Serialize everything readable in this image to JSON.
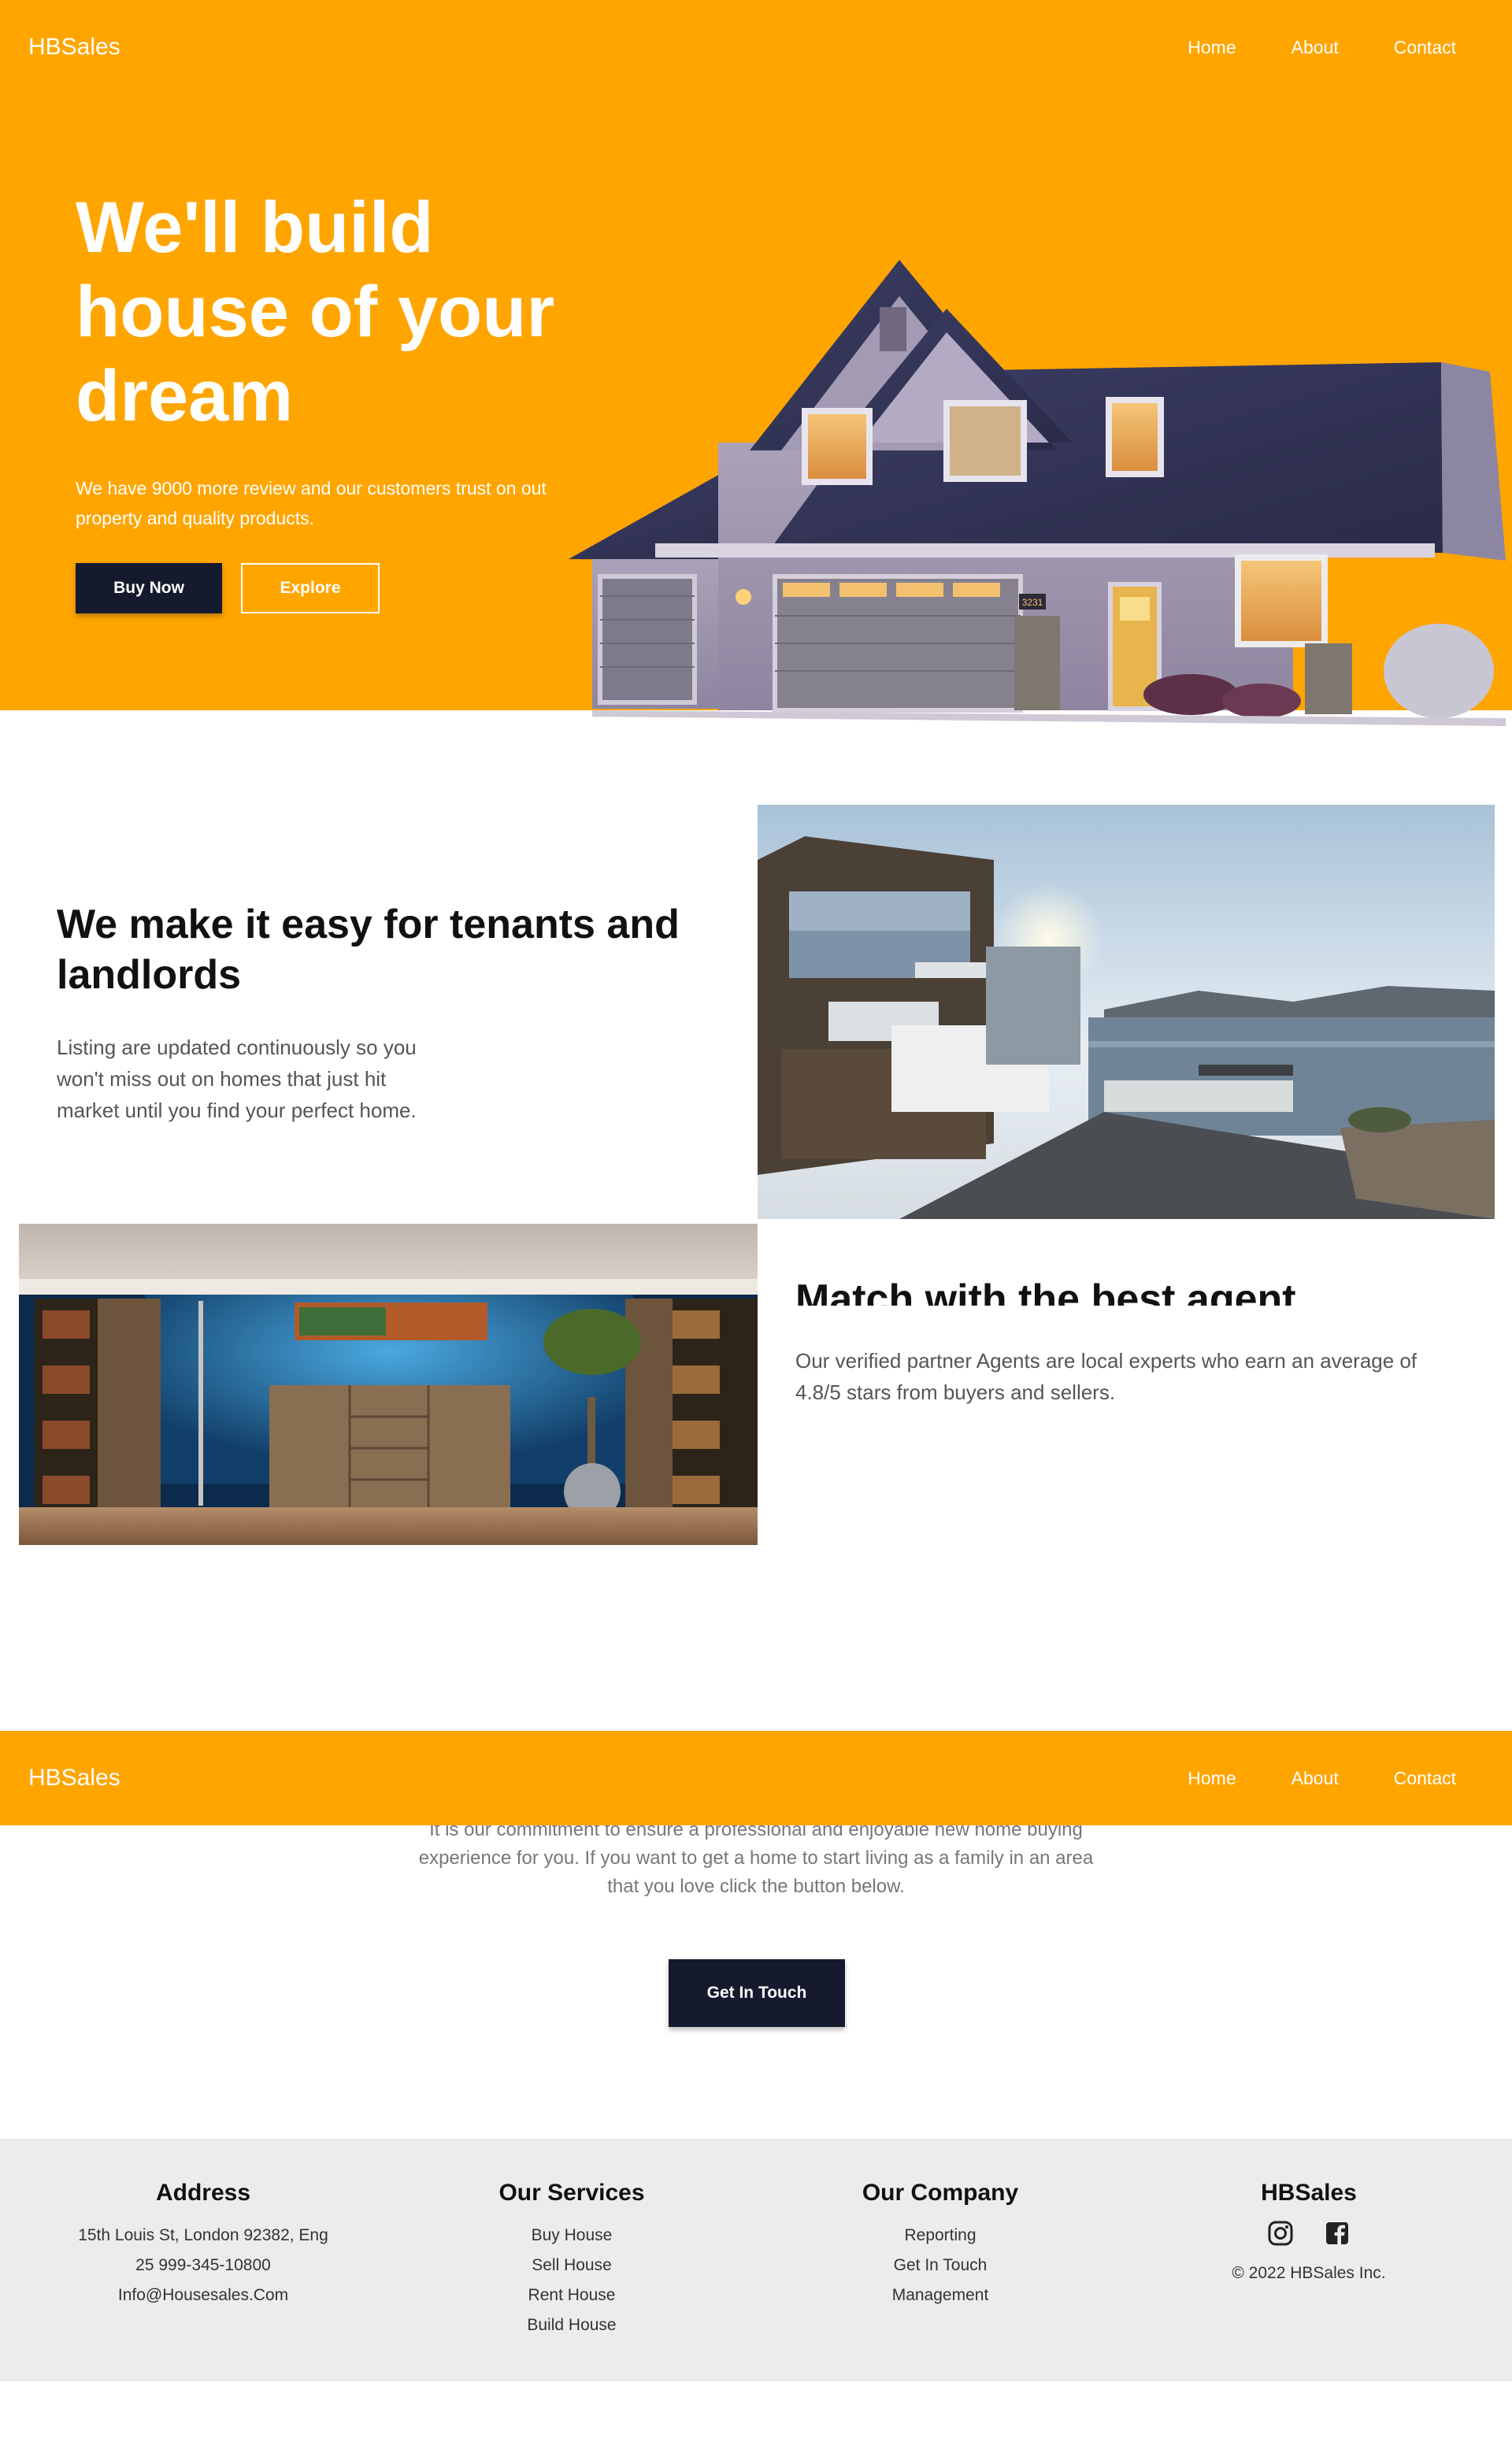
{
  "nav": {
    "brand": "HBSales",
    "links": [
      "Home",
      "About",
      "Contact"
    ]
  },
  "hero": {
    "title": "We'll build house of your dream",
    "text": "We have 9000 more review and our customers trust on out property and quality products.",
    "buy_label": "Buy Now",
    "explore_label": "Explore",
    "house_number": "3231"
  },
  "feature1": {
    "title": "We make it easy for tenants and landlords",
    "text": "Listing are updated continuously so you won't miss out on homes that just hit market until you find your perfect home."
  },
  "feature2": {
    "title": "Match with the best agent",
    "text": "Our verified partner Agents are local experts who earn an average of 4.8/5 stars from buyers and sellers."
  },
  "cta": {
    "text": "It is our commitment to ensure a professional and enjoyable new home buying experience for you. If you want to get a home to start living as a family in an area that you love click the button below.",
    "button_label": "Get In Touch"
  },
  "footer": {
    "address": {
      "title": "Address",
      "lines": [
        "15th Louis St, London 92382, Eng",
        "25 999-345-10800",
        "Info@Housesales.Com"
      ]
    },
    "services": {
      "title": "Our Services",
      "items": [
        "Buy House",
        "Sell House",
        "Rent House",
        "Build House"
      ]
    },
    "company": {
      "title": "Our Company",
      "items": [
        "Reporting",
        "Get In Touch",
        "Management"
      ]
    },
    "brand": {
      "title": "HBSales",
      "icons": [
        "instagram-icon",
        "facebook-icon"
      ],
      "copyright": "© 2022 HBSales Inc."
    }
  },
  "colors": {
    "brand_orange": "#ffa500",
    "dark_button": "#151a2e",
    "footer_bg": "#ececec"
  }
}
